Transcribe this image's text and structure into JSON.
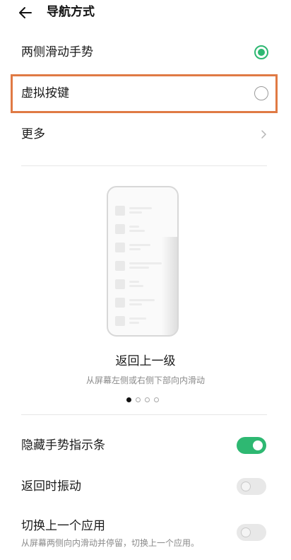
{
  "header": {
    "title": "导航方式"
  },
  "options": [
    {
      "label": "两侧滑动手势",
      "selected": true
    },
    {
      "label": "虚拟按键",
      "selected": false
    }
  ],
  "more": {
    "label": "更多"
  },
  "illustration": {
    "title": "返回上一级",
    "subtitle": "从屏幕左侧或右侧下部向内滑动",
    "page_index": 1,
    "page_count": 4
  },
  "settings": [
    {
      "label": "隐藏手势指示条",
      "enabled": true
    },
    {
      "label": "返回时振动",
      "enabled": false
    },
    {
      "label": "切换上一个应用",
      "description": "从屏幕两侧向内滑动并停留，切换上一个应用。",
      "enabled": false
    }
  ],
  "colors": {
    "accent": "#2eb872",
    "highlight": "#e07a44"
  }
}
